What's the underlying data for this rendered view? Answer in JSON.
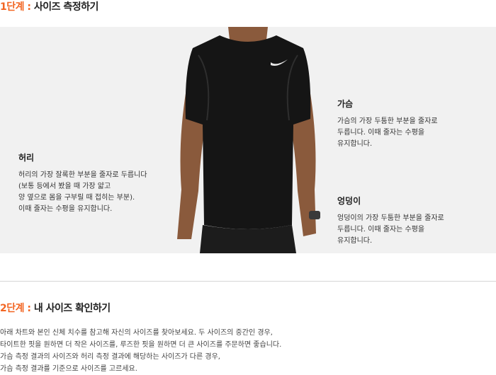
{
  "step1": {
    "number": "1단계 : ",
    "title": "사이즈 측정하기"
  },
  "step2": {
    "number": "2단계 : ",
    "title": "내 사이즈 확인하기"
  },
  "measurements": {
    "waist": {
      "heading": "허리",
      "lines": [
        "허리의 가장 잘록한 부분을 줄자로 두릅니다",
        "(보통 등에서 봤을 때 가장 얇고",
        "양 옆으로 몸을 구부릴 때 접히는 부분).",
        "이때 줄자는 수평을 유지합니다."
      ]
    },
    "chest": {
      "heading": "가슴",
      "lines": [
        "가슴의 가장 두툼한 부분을 줄자로",
        "두릅니다. 이때 줄자는 수평을",
        "유지합니다."
      ]
    },
    "hip": {
      "heading": "엉덩이",
      "lines": [
        "엉덩이의 가장 두툼한 부분을 줄자로",
        "두릅니다. 이때 줄자는 수평을",
        "유지합니다."
      ]
    }
  },
  "guide": {
    "lines": [
      "아래 차트와 본인 신체 치수를 참고해 자신의 사이즈를 찾아보세요. 두 사이즈의 중간인 경우,",
      "타이트한 핏을 원하면 더 작은 사이즈를, 루즈한 핏을 원하면 더 큰 사이즈를 주문하면 좋습니다.",
      "가슴 측정 결과의 사이즈와 허리 측정 결과에 해당하는 사이즈가 다른 경우,",
      "가슴 측정 결과를 기준으로 사이즈를 고르세요."
    ]
  },
  "colors": {
    "accent": "#f26522",
    "shirt": "#151515",
    "skin": "#8a5a3c"
  }
}
